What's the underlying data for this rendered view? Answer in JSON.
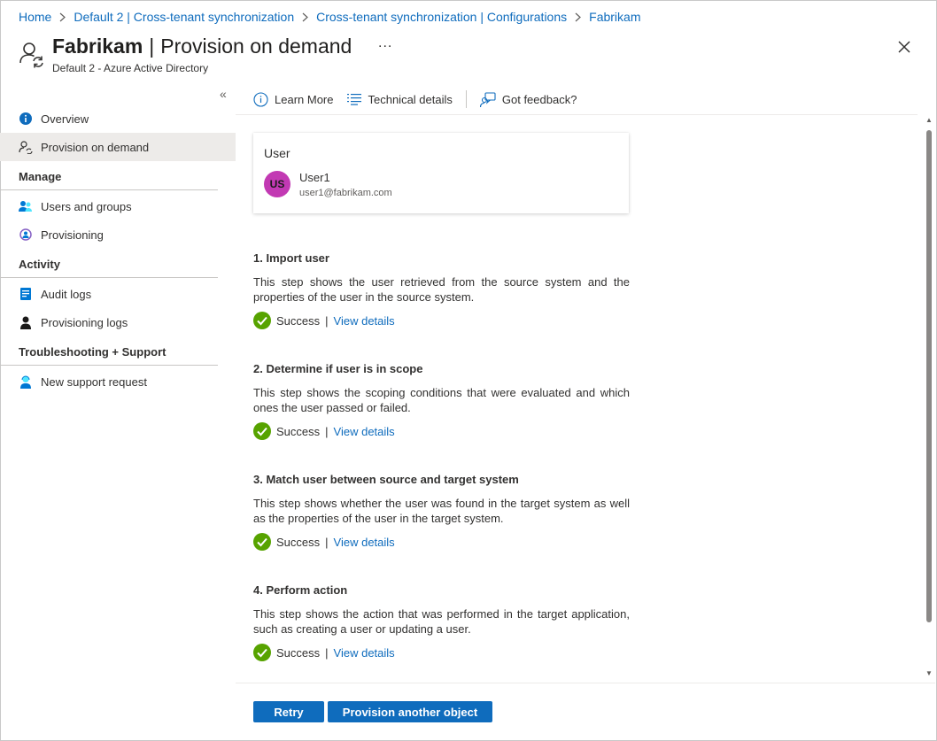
{
  "breadcrumb": {
    "items": [
      "Home",
      "Default 2 | Cross-tenant synchronization",
      "Cross-tenant synchronization | Configurations",
      "Fabrikam"
    ]
  },
  "header": {
    "title": "Fabrikam",
    "separator": "|",
    "subtitle_page": "Provision on demand",
    "more": "...",
    "directory": "Default 2 - Azure Active Directory"
  },
  "sidebar": {
    "collapse": "«",
    "items": [
      {
        "label": "Overview",
        "icon": "info-icon"
      },
      {
        "label": "Provision on demand",
        "icon": "user-sync-icon",
        "active": true
      }
    ],
    "sections": [
      {
        "title": "Manage",
        "items": [
          {
            "label": "Users and groups",
            "icon": "users-icon"
          },
          {
            "label": "Provisioning",
            "icon": "provisioning-icon"
          }
        ]
      },
      {
        "title": "Activity",
        "items": [
          {
            "label": "Audit logs",
            "icon": "audit-log-icon"
          },
          {
            "label": "Provisioning logs",
            "icon": "provisioning-log-icon"
          }
        ]
      },
      {
        "title": "Troubleshooting + Support",
        "items": [
          {
            "label": "New support request",
            "icon": "support-icon"
          }
        ]
      }
    ]
  },
  "toolbar": {
    "learn_more": "Learn More",
    "technical_details": "Technical details",
    "feedback": "Got feedback?"
  },
  "user_card": {
    "title": "User",
    "initials": "US",
    "name": "User1",
    "email": "user1@fabrikam.com"
  },
  "steps": [
    {
      "title": "1. Import user",
      "description": "This step shows the user retrieved from the source system and the properties of the user in the source system.",
      "status": "Success",
      "link": "View details"
    },
    {
      "title": "2. Determine if user is in scope",
      "description": "This step shows the scoping conditions that were evaluated and which ones the user passed or failed.",
      "status": "Success",
      "link": "View details"
    },
    {
      "title": "3. Match user between source and target system",
      "description": "This step shows whether the user was found in the target system as well as the properties of the user in the target system.",
      "status": "Success",
      "link": "View details"
    },
    {
      "title": "4. Perform action",
      "description": "This step shows the action that was performed in the target application, such as creating a user or updating a user.",
      "status": "Success",
      "link": "View details"
    }
  ],
  "footer": {
    "retry": "Retry",
    "provision_another": "Provision another object"
  },
  "colors": {
    "accent": "#0f6cbd",
    "success": "#57a300",
    "avatar": "#c239b3"
  }
}
